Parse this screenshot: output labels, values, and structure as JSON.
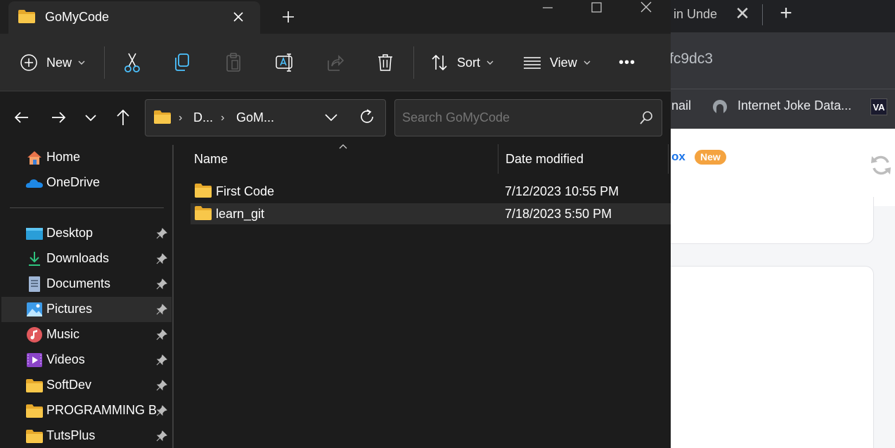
{
  "browser": {
    "tab_title": "in Unde",
    "address_text": "fc9dc3",
    "bookmarks": [
      {
        "label": "nail",
        "icon": "bookmark-partial"
      },
      {
        "label": "Internet Joke Data...",
        "icon": "joke-api-icon"
      },
      {
        "label": "VA",
        "icon": "va-logo"
      }
    ],
    "content": {
      "heading_fragment": "ox",
      "badge": "New"
    }
  },
  "explorer": {
    "tab_title": "GoMyCode",
    "toolbar": {
      "new_label": "New",
      "sort_label": "Sort",
      "view_label": "View",
      "more_label": "•••"
    },
    "breadcrumb": [
      "D...",
      "GoM..."
    ],
    "breadcrumb_sep": "›",
    "search_placeholder": "Search GoMyCode",
    "sidebar": {
      "top_items": [
        {
          "label": "Home",
          "icon": "home-icon"
        },
        {
          "label": "OneDrive",
          "icon": "onedrive-icon"
        }
      ],
      "quick_access": [
        {
          "label": "Desktop",
          "icon": "desktop-icon",
          "pinned": true
        },
        {
          "label": "Downloads",
          "icon": "download-icon",
          "pinned": true
        },
        {
          "label": "Documents",
          "icon": "document-icon",
          "pinned": true
        },
        {
          "label": "Pictures",
          "icon": "pictures-icon",
          "pinned": true,
          "selected": true
        },
        {
          "label": "Music",
          "icon": "music-icon",
          "pinned": true
        },
        {
          "label": "Videos",
          "icon": "video-icon",
          "pinned": true
        },
        {
          "label": "SoftDev",
          "icon": "folder-icon",
          "pinned": true
        },
        {
          "label": "PROGRAMMING BO",
          "icon": "folder-icon",
          "pinned": true
        },
        {
          "label": "TutsPlus",
          "icon": "folder-icon",
          "pinned": true
        }
      ]
    },
    "columns": {
      "name": "Name",
      "date_modified": "Date modified"
    },
    "files": [
      {
        "name": "First Code",
        "date": "7/12/2023 10:55 PM",
        "selected": false
      },
      {
        "name": "learn_git",
        "date": "7/18/2023 5:50 PM",
        "selected": true
      }
    ],
    "colors": {
      "folder": "#f8c74a",
      "folder_dark": "#e6a92b",
      "accent_blue": "#4cc2ff"
    }
  }
}
